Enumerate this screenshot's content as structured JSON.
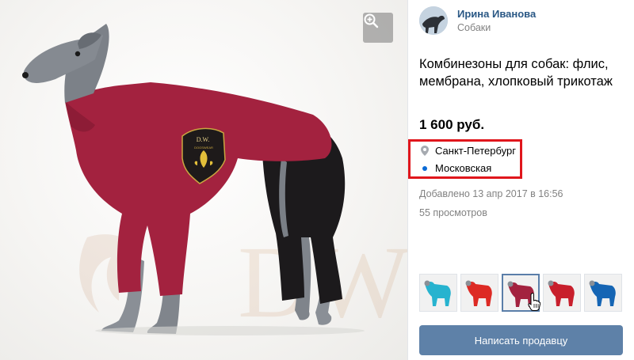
{
  "owner": {
    "name": "Ирина Иванова",
    "group": "Собаки"
  },
  "item": {
    "title": "Комбинезоны для собак: флис, мембрана, хлопковый трикотаж",
    "price": "1 600 руб.",
    "location": {
      "city": "Санкт-Петербург",
      "metro": "Московская"
    },
    "added": "Добавлено 13 апр 2017 в 16:56",
    "views": "55 просмотров"
  },
  "photo": {
    "patch_top": "D.W.",
    "patch_bottom": "DOGSWEAR",
    "watermark": "DW",
    "suit_color": "#a3223f",
    "pants_color": "#1c1a1c"
  },
  "thumbnails": [
    {
      "color": "#27b3cf",
      "active": false
    },
    {
      "color": "#dd2a24",
      "active": false
    },
    {
      "color": "#a3223f",
      "active": true
    },
    {
      "color": "#c81f2c",
      "active": false
    },
    {
      "color": "#1565b4",
      "active": false
    }
  ],
  "actions": {
    "zoom_icon": "zoom-in-icon",
    "write_seller": "Написать продавцу"
  },
  "colors": {
    "link": "#2a5885",
    "button": "#5e81a8",
    "highlight": "#e0161c",
    "metro_dot": "#0a6ad6"
  }
}
